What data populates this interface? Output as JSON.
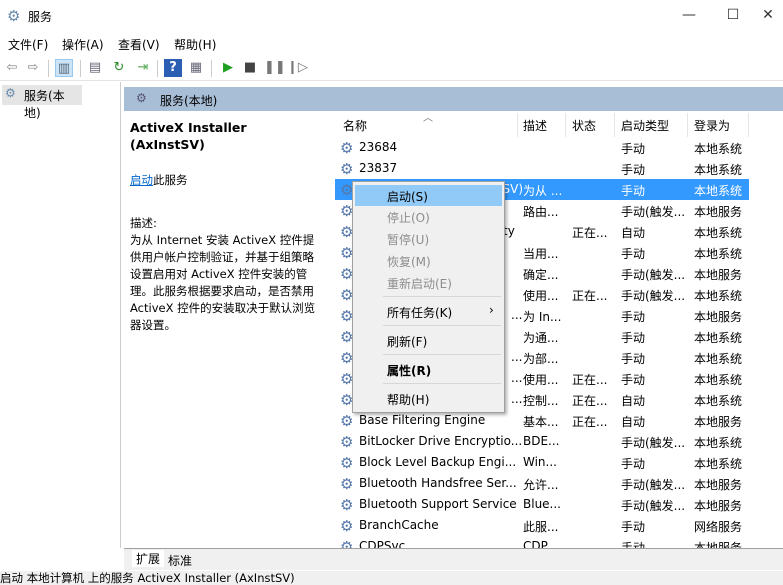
{
  "window": {
    "title": "服务",
    "minimize": "—",
    "maximize": "☐",
    "close": "✕"
  },
  "menu": [
    "文件(F)",
    "操作(A)",
    "查看(V)",
    "帮助(H)"
  ],
  "toolbar": [
    "back-icon",
    "forward-icon",
    "show-hide-tree-icon",
    "properties-icon",
    "refresh-icon",
    "export-icon",
    "help-icon",
    "console-icon",
    "start-icon",
    "stop-icon",
    "pause-icon",
    "resume-icon"
  ],
  "tree": {
    "item": "服务(本地)"
  },
  "pane_header": "服务(本地)",
  "detail": {
    "title": "ActiveX Installer (AxInstSV)",
    "start_link": "启动",
    "start_suffix": "此服务",
    "desc_label": "描述:",
    "desc_text": "为从 Internet 安装 ActiveX 控件提供用户帐户控制验证，并基于组策略设置启用对 ActiveX 控件安装的管理。此服务根据要求启动，是否禁用 ActiveX 控件的安装取决于默认浏览器设置。"
  },
  "columns": [
    "名称",
    "描述",
    "状态",
    "启动类型",
    "登录为"
  ],
  "rows": [
    {
      "name": "23684",
      "desc": "",
      "status": "",
      "type": "手动",
      "logon": "本地系统"
    },
    {
      "name": "23837",
      "desc": "",
      "status": "",
      "type": "手动",
      "logon": "本地系统"
    },
    {
      "name": "ActiveX Installer (AxInstSV)",
      "desc": "为从 ...",
      "status": "",
      "type": "手动",
      "logon": "本地系统",
      "selected": true
    },
    {
      "name": "",
      "desc": "路由...",
      "status": "",
      "type": "手动(触发...",
      "logon": "本地服务"
    },
    {
      "name": "ty",
      "desc": "",
      "status": "正在...",
      "type": "自动",
      "logon": "本地系统"
    },
    {
      "name": "",
      "desc": "当用...",
      "status": "",
      "type": "手动",
      "logon": "本地系统"
    },
    {
      "name": "",
      "desc": "确定...",
      "status": "",
      "type": "手动(触发...",
      "logon": "本地服务"
    },
    {
      "name": "",
      "desc": "使用...",
      "status": "正在...",
      "type": "手动(触发...",
      "logon": "本地系统"
    },
    {
      "name": "...",
      "desc": "为 In...",
      "status": "",
      "type": "手动",
      "logon": "本地服务"
    },
    {
      "name": "",
      "desc": "为通...",
      "status": "",
      "type": "手动",
      "logon": "本地系统"
    },
    {
      "name": "...",
      "desc": "为部...",
      "status": "",
      "type": "手动",
      "logon": "本地系统"
    },
    {
      "name": "...",
      "desc": "使用...",
      "status": "正在...",
      "type": "手动",
      "logon": "本地系统"
    },
    {
      "name": "...",
      "desc": "控制...",
      "status": "正在...",
      "type": "自动",
      "logon": "本地系统"
    },
    {
      "name": "Base Filtering Engine",
      "desc": "基本...",
      "status": "正在...",
      "type": "自动",
      "logon": "本地服务"
    },
    {
      "name": "BitLocker Drive Encryptio...",
      "desc": "BDE...",
      "status": "",
      "type": "手动(触发...",
      "logon": "本地系统"
    },
    {
      "name": "Block Level Backup Engi...",
      "desc": "Win...",
      "status": "",
      "type": "手动",
      "logon": "本地系统"
    },
    {
      "name": "Bluetooth Handsfree Ser...",
      "desc": "允许...",
      "status": "",
      "type": "手动(触发...",
      "logon": "本地服务"
    },
    {
      "name": "Bluetooth Support Service",
      "desc": "Blue...",
      "status": "",
      "type": "手动(触发...",
      "logon": "本地服务"
    },
    {
      "name": "BranchCache",
      "desc": "此服...",
      "status": "",
      "type": "手动",
      "logon": "网络服务"
    },
    {
      "name": "CDPSvc",
      "desc": "CDP...",
      "status": "",
      "type": "手动",
      "logon": "本地服务"
    }
  ],
  "context_menu": [
    {
      "label": "启动(S)",
      "state": "highlighted"
    },
    {
      "label": "停止(O)",
      "state": "disabled"
    },
    {
      "label": "暂停(U)",
      "state": "disabled"
    },
    {
      "label": "恢复(M)",
      "state": "disabled"
    },
    {
      "label": "重新启动(E)",
      "state": "disabled"
    },
    {
      "label": "所有任务(K)",
      "submenu": true
    },
    {
      "label": "刷新(F)"
    },
    {
      "label": "属性(R)",
      "bold": true
    },
    {
      "label": "帮助(H)"
    }
  ],
  "tabs": [
    "扩展",
    "标准"
  ],
  "status": "启动 本地计算机 上的服务 ActiveX Installer (AxInstSV)",
  "colors": {
    "selection": "#3399ff",
    "menu_highlight": "#91c9f7",
    "pane_header": "#a8bdd6"
  }
}
